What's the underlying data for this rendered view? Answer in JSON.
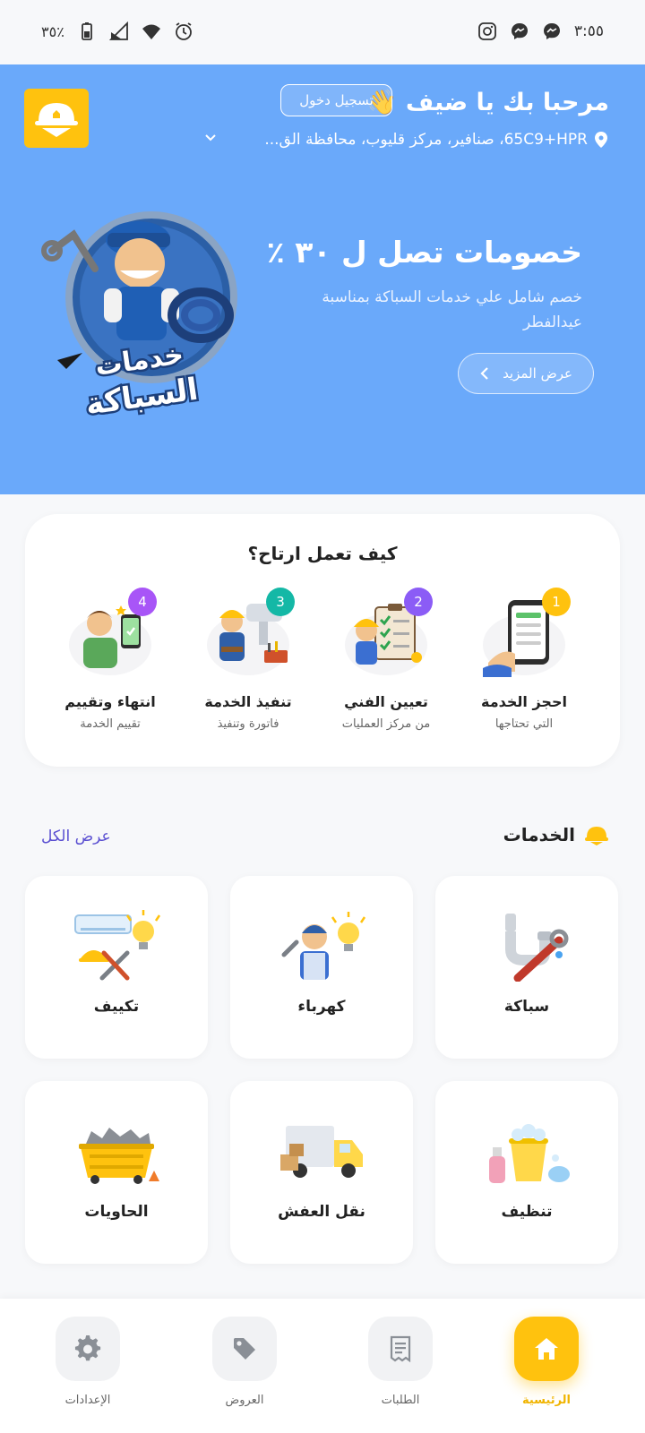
{
  "status_bar": {
    "time": "٣:٥٥",
    "battery": "٣٥٪",
    "icons": [
      "instagram-icon",
      "messenger-icon",
      "messenger-icon",
      "alarm-icon",
      "wifi-icon",
      "signal-icon",
      "battery-icon"
    ]
  },
  "header": {
    "greeting": "مرحبا بك يا ضيف 👋",
    "login_label": "تسجيل دخول",
    "location": "65C9+HPR، صنافير، مركز قليوب، محافظة الق..."
  },
  "promo": {
    "title": "خصومات تصل ل ٣٠ ٪",
    "description": "خصم شامل علي خدمات السباكة بمناسبة عيدالفطر",
    "more_label": "عرض المزيد",
    "mascot_text_line1": "خدمات",
    "mascot_text_line2": "السباكة"
  },
  "how_it_works": {
    "title": "كيف تعمل ارتاح؟",
    "steps": [
      {
        "number": "1",
        "title": "احجز الخدمة",
        "subtitle": "التي تحتاجها",
        "color": "#ffc20e"
      },
      {
        "number": "2",
        "title": "تعيين الفني",
        "subtitle": "من مركز العمليات",
        "color": "#8b5cf6"
      },
      {
        "number": "3",
        "title": "تنفيذ الخدمة",
        "subtitle": "فاتورة وتنفيذ",
        "color": "#14b8a6"
      },
      {
        "number": "4",
        "title": "انتهاء وتقييم",
        "subtitle": "تقييم الخدمة",
        "color": "#a855f7"
      }
    ]
  },
  "services": {
    "title": "الخدمات",
    "view_all": "عرض الكل",
    "items": [
      {
        "label": "سباكة",
        "icon": "plumbing-icon"
      },
      {
        "label": "كهرباء",
        "icon": "electrician-icon"
      },
      {
        "label": "تكييف",
        "icon": "air-conditioning-icon"
      },
      {
        "label": "تنظيف",
        "icon": "cleaning-icon"
      },
      {
        "label": "نقل العفش",
        "icon": "moving-truck-icon"
      },
      {
        "label": "الحاويات",
        "icon": "container-icon"
      }
    ]
  },
  "bottom_nav": {
    "items": [
      {
        "label": "الرئيسية",
        "icon": "home-icon",
        "active": true
      },
      {
        "label": "الطلبات",
        "icon": "orders-icon",
        "active": false
      },
      {
        "label": "العروض",
        "icon": "tag-icon",
        "active": false
      },
      {
        "label": "الإعدادات",
        "icon": "gear-icon",
        "active": false
      }
    ]
  },
  "colors": {
    "primary_blue": "#6aa9fa",
    "accent_yellow": "#ffc20e",
    "link_purple": "#5a4fd1"
  }
}
